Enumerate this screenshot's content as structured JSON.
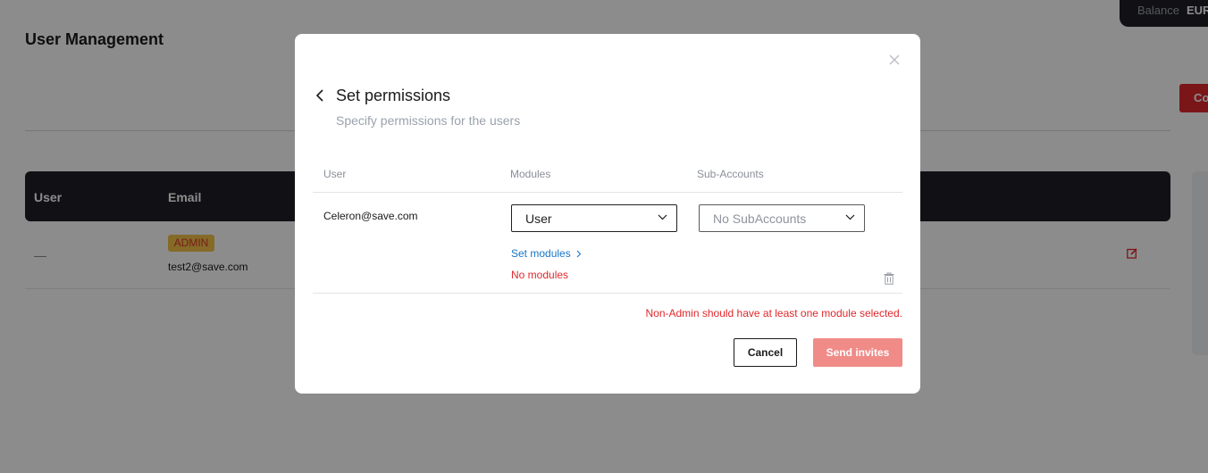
{
  "background": {
    "balance_label": "Balance",
    "balance_currency": "EUR",
    "page_title": "User Management",
    "create_button_label": "Co",
    "table": {
      "columns": [
        "User",
        "Email"
      ],
      "rows": [
        {
          "user": "—",
          "badge": "ADMIN",
          "email": "test2@save.com"
        }
      ]
    }
  },
  "modal": {
    "title": "Set permissions",
    "subtitle": "Specify permissions for the users",
    "columns": {
      "user": "User",
      "modules": "Modules",
      "subaccounts": "Sub-Accounts"
    },
    "row": {
      "email": "Celeron@save.com",
      "role_value": "User",
      "subaccounts_placeholder": "No SubAccounts",
      "set_modules_link": "Set modules",
      "modules_status": "No modules"
    },
    "error_message": "Non-Admin should have at least one module selected.",
    "cancel_label": "Cancel",
    "send_label": "Send invites"
  },
  "colors": {
    "accent_red": "#e0282c",
    "link_blue": "#1a75c7",
    "dark_header": "#1f2027",
    "send_disabled": "#f08b88"
  },
  "icons": [
    "close-icon",
    "back-arrow-icon",
    "chevron-down-icon",
    "chevron-right-icon",
    "trash-icon",
    "edit-icon"
  ]
}
